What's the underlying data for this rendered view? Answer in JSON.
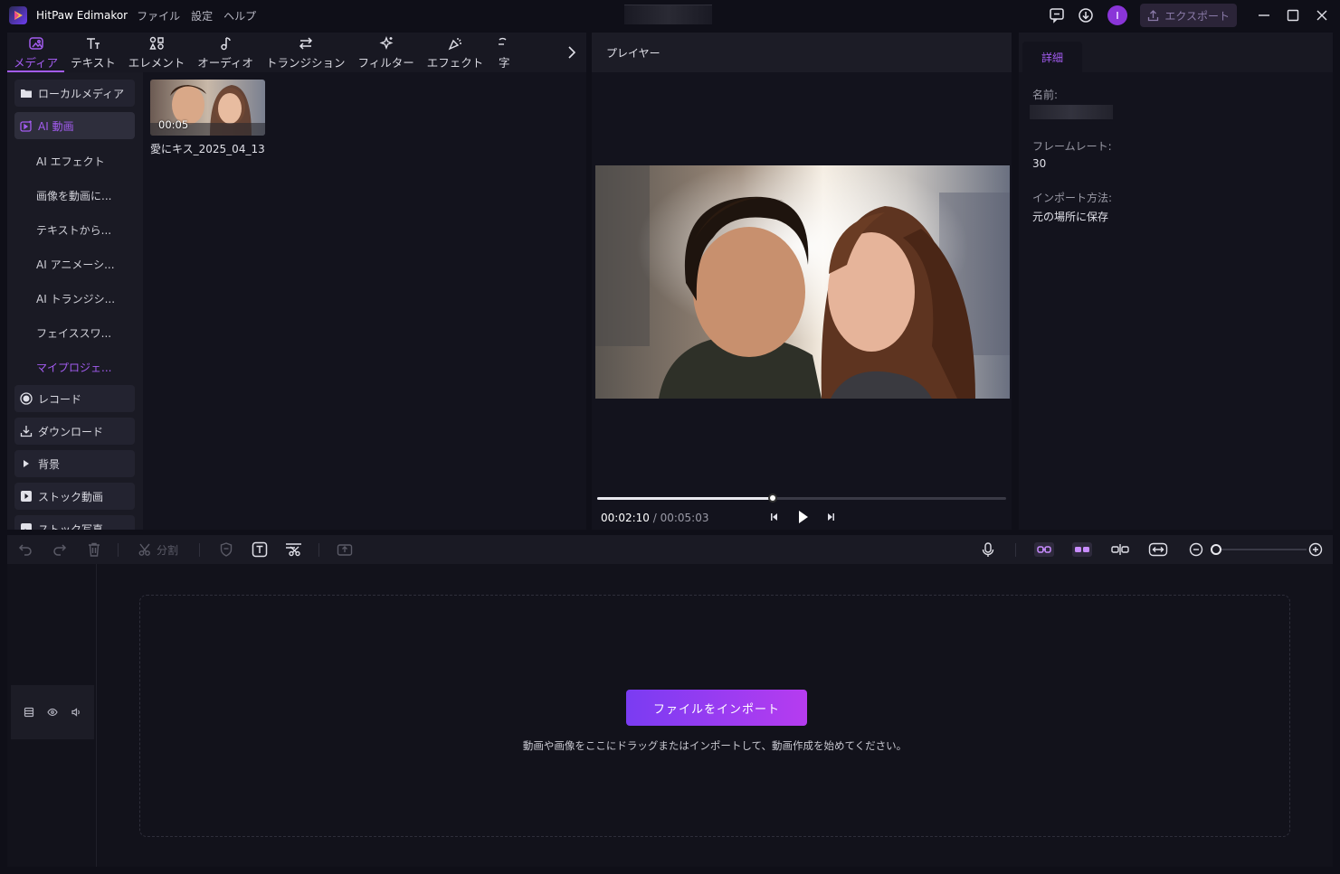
{
  "app": {
    "name": "HitPaw Edimakor",
    "menu": [
      "ファイル",
      "設定",
      "ヘルプ"
    ],
    "export_label": "エクスポート"
  },
  "tool_tabs": [
    {
      "label": "メディア",
      "icon": "media-icon",
      "active": true
    },
    {
      "label": "テキスト",
      "icon": "text-icon",
      "active": false
    },
    {
      "label": "エレメント",
      "icon": "element-icon",
      "active": false
    },
    {
      "label": "オーディオ",
      "icon": "audio-icon",
      "active": false
    },
    {
      "label": "トランジション",
      "icon": "transition-icon",
      "active": false
    },
    {
      "label": "フィルター",
      "icon": "filter-icon",
      "active": false
    },
    {
      "label": "エフェクト",
      "icon": "effect-icon",
      "active": false
    },
    {
      "label": "字",
      "icon": "subtitle-icon",
      "active": false
    }
  ],
  "sidebar": {
    "local_media": "ローカルメディア",
    "ai_video": "AI 動画",
    "ai_subitems": [
      "AI エフェクト",
      "画像を動画に...",
      "テキストから...",
      "AI アニメーシ...",
      "AI トランジシ...",
      "フェイススワ...",
      "マイプロジェ..."
    ],
    "record": "レコード",
    "download": "ダウンロード",
    "background": "背景",
    "stock_video": "ストック動画",
    "stock_photo": "ストック写真"
  },
  "media_item": {
    "duration": "00:05",
    "name": "愛にキス_2025_04_13"
  },
  "player": {
    "title": "プレイヤー",
    "current_time": "00:02:10",
    "total_time": " / 00:05:03",
    "progress": 0.43
  },
  "details": {
    "tab": "詳細",
    "name_label": "名前:",
    "framerate_label": "フレームレート:",
    "framerate_value": "30",
    "import_label": "インポート方法:",
    "import_value": "元の場所に保存"
  },
  "timeline_toolbar": {
    "split_label": "分割",
    "zoom": 0.0
  },
  "timeline": {
    "import_button": "ファイルをインポート",
    "hint": "動画や画像をここにドラッグまたはインポートして、動画作成を始めてください。"
  },
  "colors": {
    "accent": "#a35cf0",
    "import_gradient_start": "#7a3cf2",
    "import_gradient_end": "#b63cf0"
  }
}
